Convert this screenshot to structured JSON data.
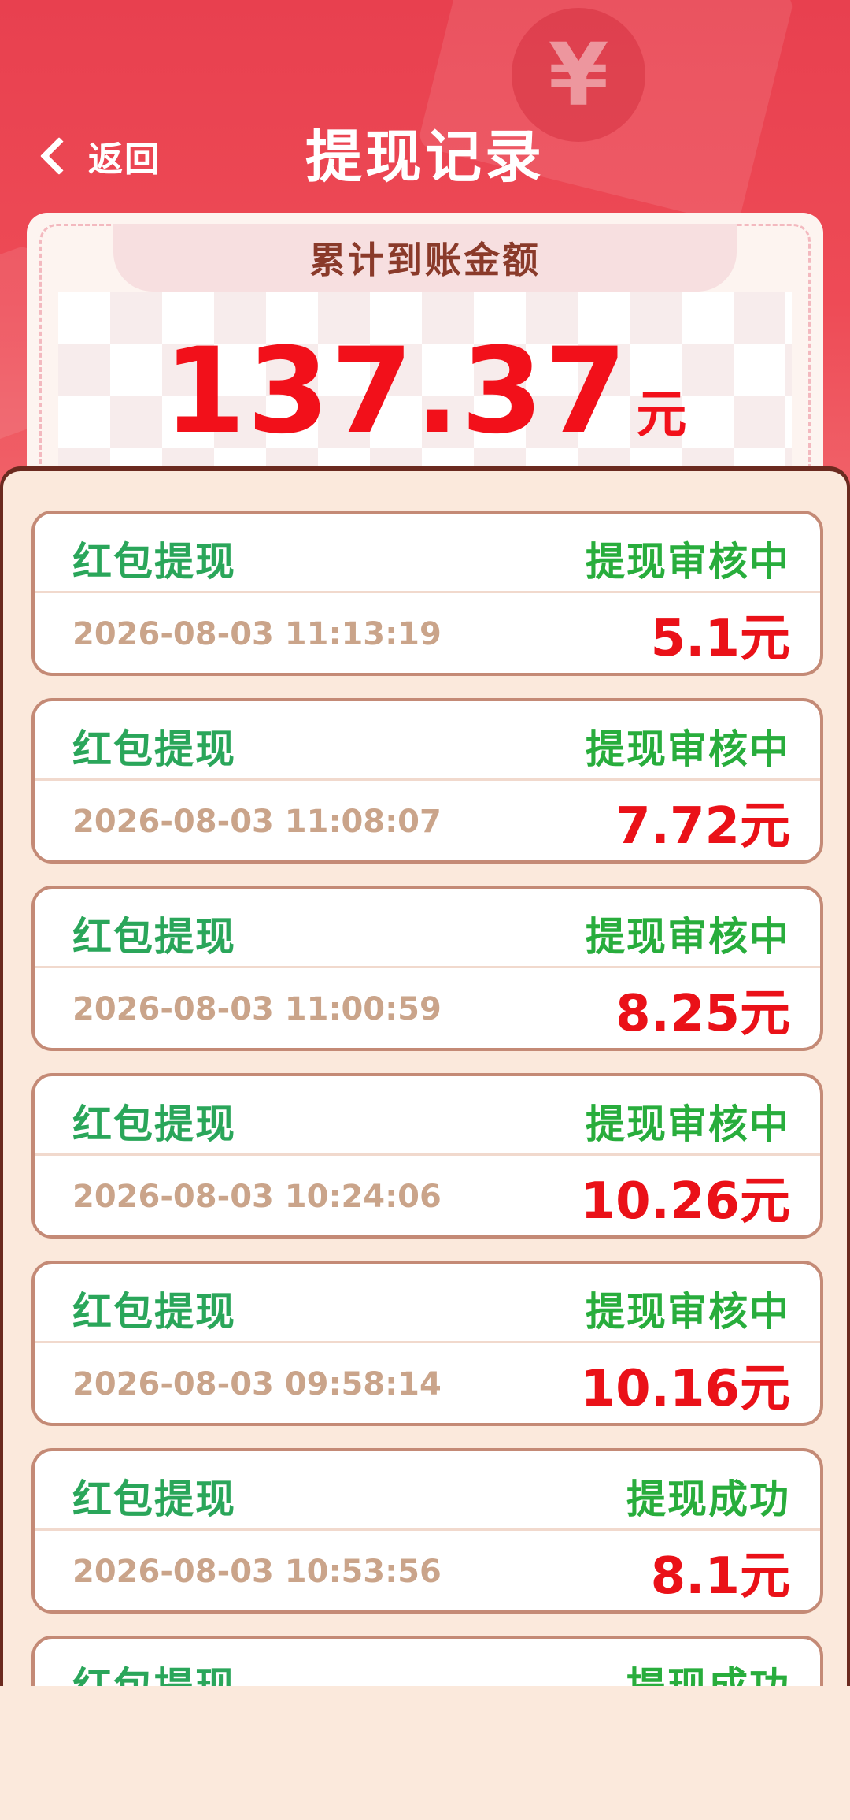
{
  "nav": {
    "back_label": "返回",
    "title": "提现记录"
  },
  "summary": {
    "label": "累计到账金额",
    "amount": "137.37",
    "unit": "元"
  },
  "records": [
    {
      "type": "红包提现",
      "status": "提现审核中",
      "time": "2026-08-03 11:13:19",
      "amount": "5.1元"
    },
    {
      "type": "红包提现",
      "status": "提现审核中",
      "time": "2026-08-03 11:08:07",
      "amount": "7.72元"
    },
    {
      "type": "红包提现",
      "status": "提现审核中",
      "time": "2026-08-03 11:00:59",
      "amount": "8.25元"
    },
    {
      "type": "红包提现",
      "status": "提现审核中",
      "time": "2026-08-03 10:24:06",
      "amount": "10.26元"
    },
    {
      "type": "红包提现",
      "status": "提现审核中",
      "time": "2026-08-03 09:58:14",
      "amount": "10.16元"
    },
    {
      "type": "红包提现",
      "status": "提现成功",
      "time": "2026-08-03 10:53:56",
      "amount": "8.1元"
    },
    {
      "type": "红包提现",
      "status": "提现成功",
      "time": "",
      "amount": ""
    }
  ],
  "colors": {
    "header_red": "#e8404f",
    "amount_red": "#f2101a",
    "status_green": "#28ad3c",
    "panel_bg": "#fbe9dc"
  },
  "icons": {
    "back": "chevron-left-icon",
    "decoration": "red-envelope-icon"
  }
}
